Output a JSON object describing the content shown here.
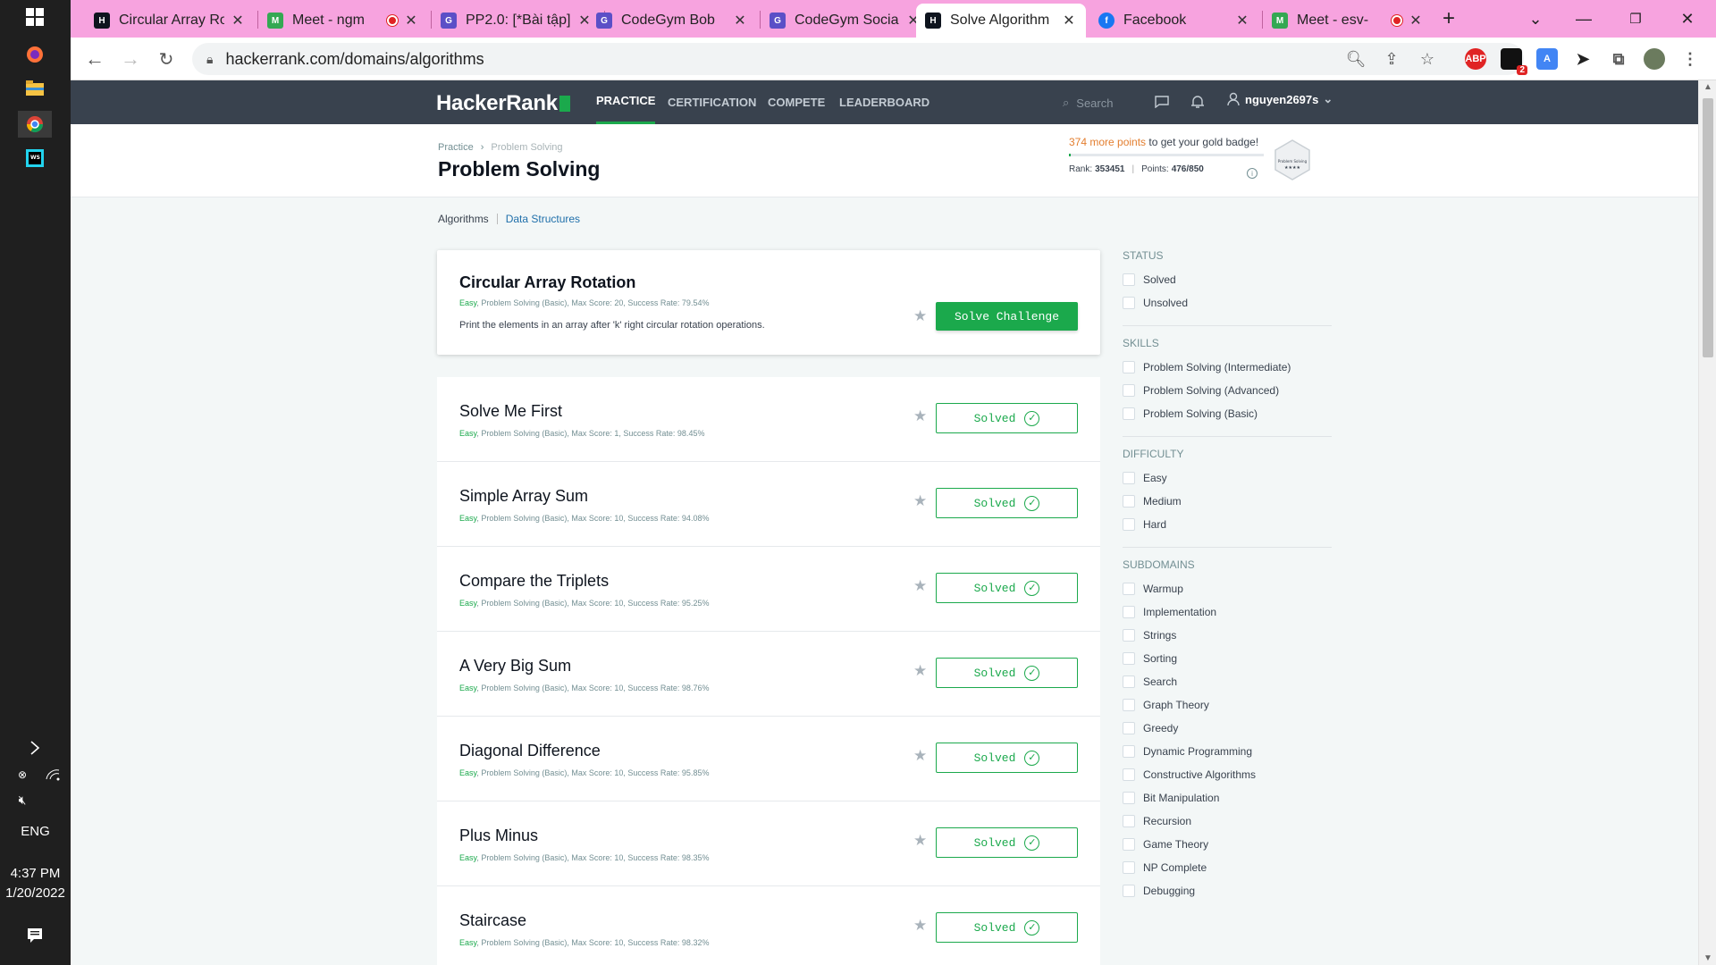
{
  "taskbar": {
    "language": "ENG",
    "time": "4:37 PM",
    "date": "1/20/2022"
  },
  "browser": {
    "tabs": [
      {
        "title": "Circular Array Ro",
        "icon": "hackerrank-favicon",
        "color": "#0e141e",
        "recording": false
      },
      {
        "title": "Meet - ngm",
        "icon": "google-meet-favicon",
        "color": "#34a853",
        "recording": true
      },
      {
        "title": "PP2.0: [*Bài tập]",
        "icon": "codegym-favicon",
        "color": "#5b4fc7",
        "recording": false
      },
      {
        "title": "CodeGym Bob",
        "icon": "codegym-favicon",
        "color": "#5b4fc7",
        "recording": false
      },
      {
        "title": "CodeGym Socia",
        "icon": "codegym-favicon",
        "color": "#5b4fc7",
        "recording": false
      },
      {
        "title": "Solve Algorithm",
        "icon": "hackerrank-favicon",
        "color": "#0e141e",
        "recording": false
      },
      {
        "title": "Facebook",
        "icon": "facebook-favicon",
        "color": "#1877f2",
        "recording": false
      },
      {
        "title": "Meet - esv-",
        "icon": "google-meet-favicon",
        "color": "#34a853",
        "recording": true
      }
    ],
    "url": "hackerrank.com/domains/algorithms",
    "extension_badge": "2"
  },
  "hr": {
    "logo": "HackerRank",
    "nav": [
      "PRACTICE",
      "CERTIFICATION",
      "COMPETE",
      "LEADERBOARD"
    ],
    "search_placeholder": "Search",
    "username": "nguyen2697s"
  },
  "header": {
    "breadcrumb": [
      "Practice",
      "Problem Solving"
    ],
    "title": "Problem Solving",
    "badge_points": "374 more points",
    "badge_text": " to get your gold badge!",
    "badge_progress": 0.01,
    "rank_label": "Rank:",
    "rank": "353451",
    "points_label": "Points:",
    "points": "476/850",
    "hex_badge_label": "Problem Solving"
  },
  "subtabs": [
    "Algorithms",
    "Data Structures"
  ],
  "featured": {
    "name": "Circular Array Rotation",
    "difficulty": "Easy",
    "meta": ", Problem Solving (Basic), Max Score: 20, Success Rate: 79.54%",
    "description": "Print the elements in an array after 'k' right circular rotation operations.",
    "button": "Solve Challenge"
  },
  "solved_label": "Solved",
  "challenges": [
    {
      "name": "Solve Me First",
      "difficulty": "Easy",
      "meta": ", Problem Solving (Basic), Max Score: 1, Success Rate: 98.45%"
    },
    {
      "name": "Simple Array Sum",
      "difficulty": "Easy",
      "meta": ", Problem Solving (Basic), Max Score: 10, Success Rate: 94.08%"
    },
    {
      "name": "Compare the Triplets",
      "difficulty": "Easy",
      "meta": ", Problem Solving (Basic), Max Score: 10, Success Rate: 95.25%"
    },
    {
      "name": "A Very Big Sum",
      "difficulty": "Easy",
      "meta": ", Problem Solving (Basic), Max Score: 10, Success Rate: 98.76%"
    },
    {
      "name": "Diagonal Difference",
      "difficulty": "Easy",
      "meta": ", Problem Solving (Basic), Max Score: 10, Success Rate: 95.85%"
    },
    {
      "name": "Plus Minus",
      "difficulty": "Easy",
      "meta": ", Problem Solving (Basic), Max Score: 10, Success Rate: 98.35%"
    },
    {
      "name": "Staircase",
      "difficulty": "Easy",
      "meta": ", Problem Solving (Basic), Max Score: 10, Success Rate: 98.32%"
    }
  ],
  "filters": {
    "status": {
      "title": "STATUS",
      "items": [
        "Solved",
        "Unsolved"
      ]
    },
    "skills": {
      "title": "SKILLS",
      "items": [
        "Problem Solving (Intermediate)",
        "Problem Solving (Advanced)",
        "Problem Solving (Basic)"
      ]
    },
    "difficulty": {
      "title": "DIFFICULTY",
      "items": [
        "Easy",
        "Medium",
        "Hard"
      ]
    },
    "subdomains": {
      "title": "SUBDOMAINS",
      "items": [
        "Warmup",
        "Implementation",
        "Strings",
        "Sorting",
        "Search",
        "Graph Theory",
        "Greedy",
        "Dynamic Programming",
        "Constructive Algorithms",
        "Bit Manipulation",
        "Recursion",
        "Game Theory",
        "NP Complete",
        "Debugging"
      ]
    }
  },
  "colors": {
    "accent": "#1ba94c",
    "nav_bg": "#39424e",
    "tabstrip": "#f7a3df",
    "points_orange": "#e37e2f",
    "link_blue": "#1f6faa"
  }
}
